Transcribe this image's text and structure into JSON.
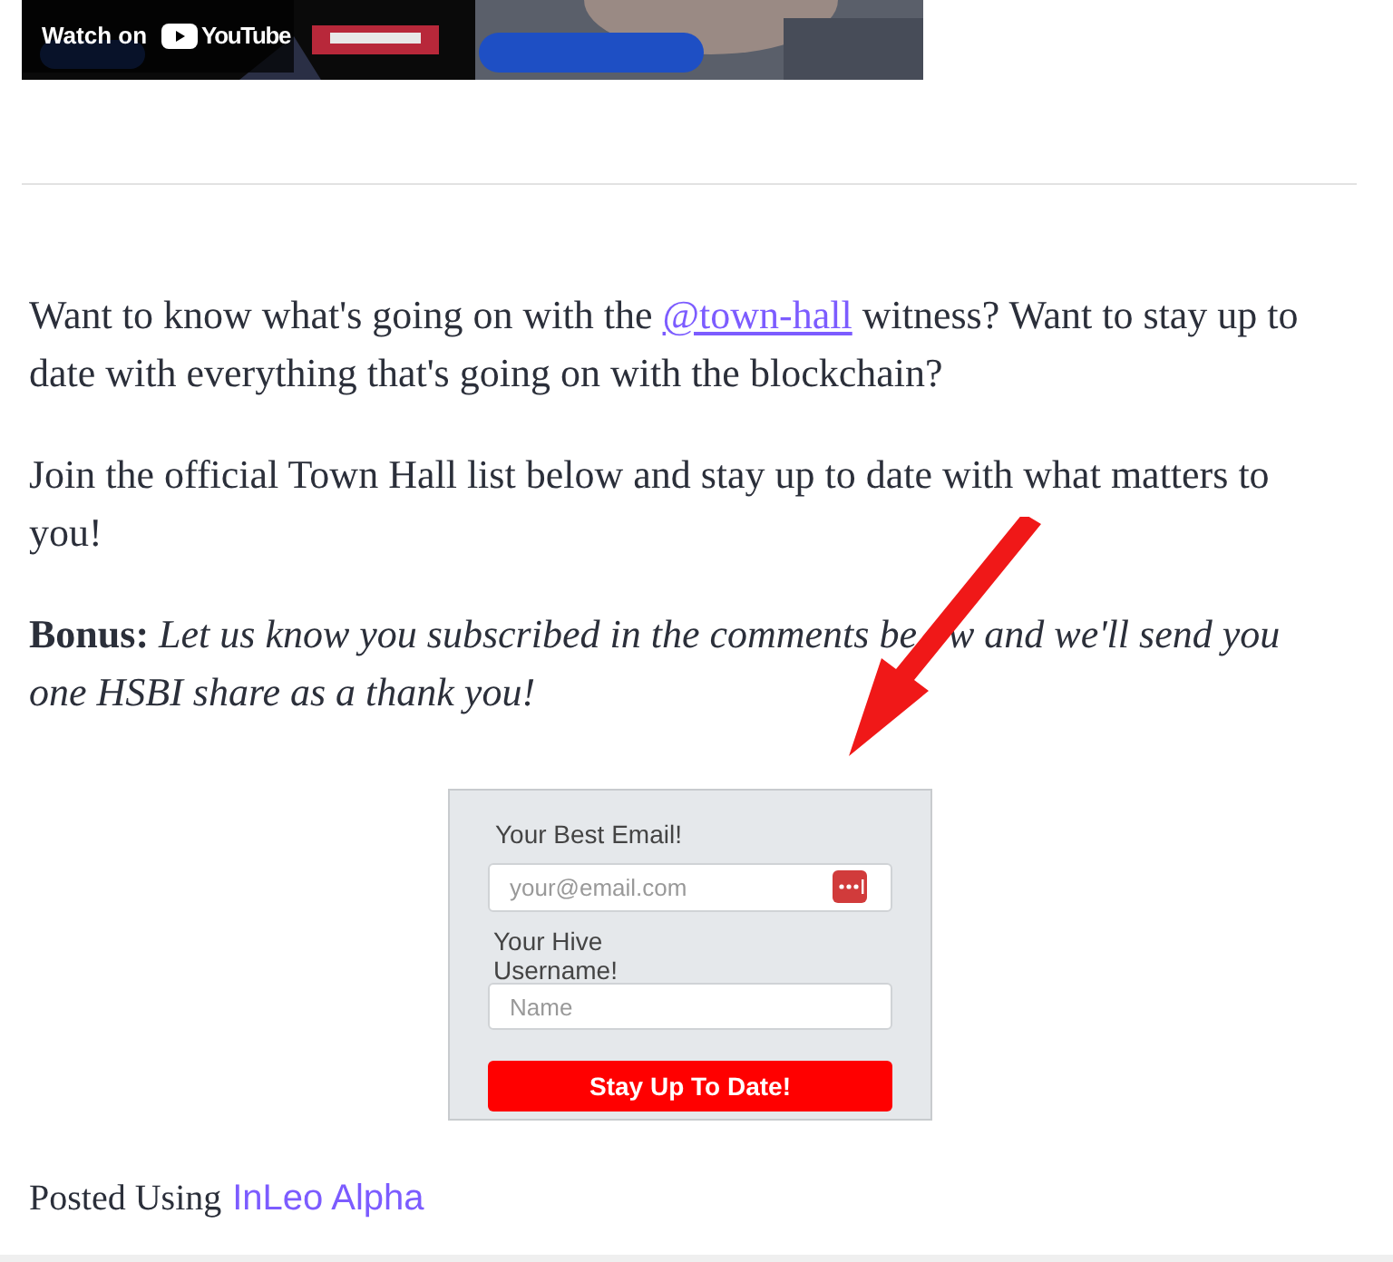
{
  "video": {
    "kind": "picture",
    "watch_label": "Watch on",
    "logo_text": "YouTube"
  },
  "paragraphs": [
    {
      "parts": [
        {
          "text": "Want to know what's going on with the "
        },
        {
          "text": "@town-hall",
          "link": true
        },
        {
          "text": " witness? Want to stay up to date with everything that's going on with the blockchain?"
        }
      ]
    },
    {
      "parts": [
        {
          "text": "Join the official Town Hall list below and stay up to date with what matters to you!"
        }
      ]
    },
    {
      "parts": [
        {
          "text": "**Bonus:** *Let us know you subscribed in the comments be*"
        },
        {
          "text": "*w and we'll send you one HSBI share as a thank you!*",
          "covered_before": true
        }
      ]
    }
  ],
  "form": {
    "email_label": "Your Best Email!",
    "email_placeholder": "your@email.com",
    "username_label": "Your Hive Username!",
    "username_placeholder": "Name",
    "submit": "Stay Up To Date!"
  },
  "footer": {
    "text": "Posted Using",
    "link": "InLeo Alpha"
  }
}
